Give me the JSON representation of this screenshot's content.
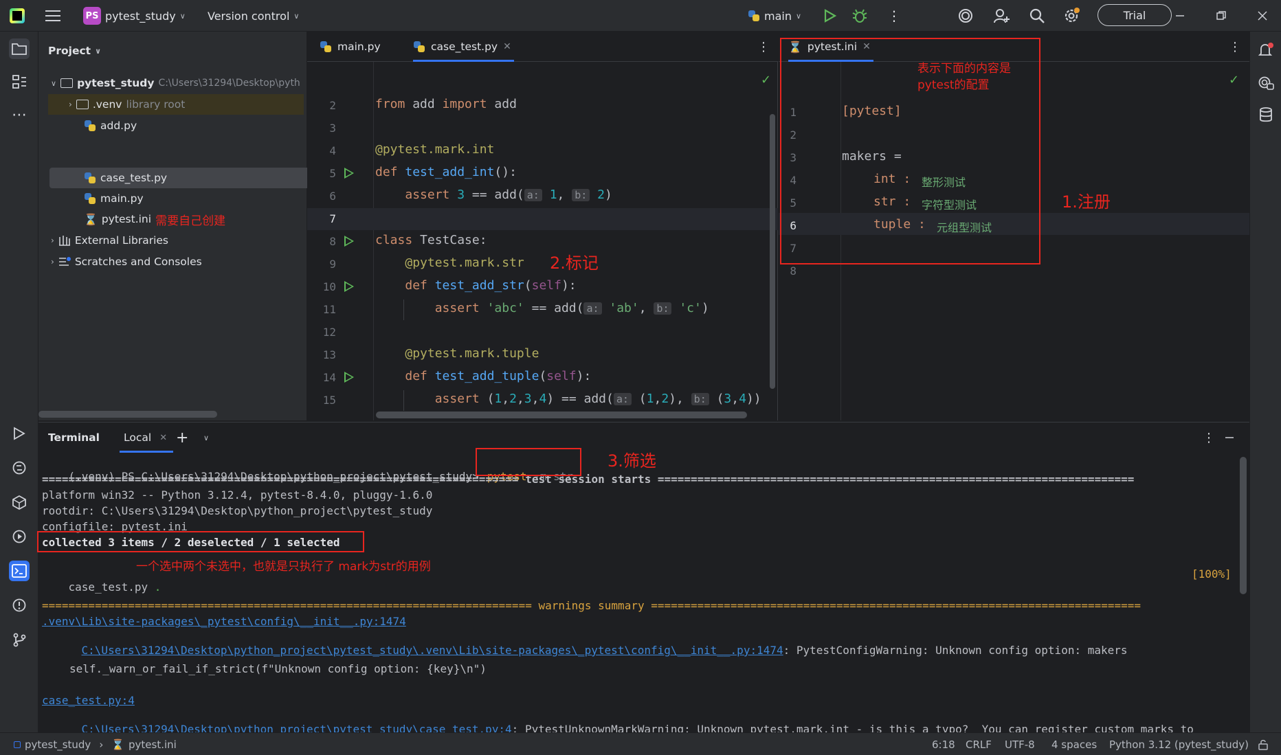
{
  "titlebar": {
    "project_badge": "PS",
    "project_name": "pytest_study",
    "vcs": "Version control",
    "branch": "main",
    "trial": "Trial"
  },
  "project_panel": {
    "title": "Project",
    "root_name": "pytest_study",
    "root_path": "C:\\Users\\31294\\Desktop\\pyth",
    "venv": ".venv",
    "venv_note": "library root",
    "files": [
      "add.py",
      "case_test.py",
      "main.py",
      "pytest.ini"
    ],
    "note_create": "需要自己创建",
    "external": "External Libraries",
    "scratches": "Scratches and Consoles"
  },
  "left_editor": {
    "tabs": [
      "main.py",
      "case_test.py"
    ],
    "line_numbers": [
      "2",
      "3",
      "4",
      "5",
      "6",
      "7",
      "8",
      "9",
      "10",
      "11",
      "12",
      "13",
      "14",
      "15"
    ],
    "annotation": "2.标记"
  },
  "right_editor": {
    "tab": "pytest.ini",
    "line_numbers": [
      "1",
      "2",
      "3",
      "4",
      "5",
      "6",
      "7",
      "8"
    ],
    "lines": {
      "l1": "[pytest]",
      "l3": "makers =",
      "l4_key": "int :",
      "l4_val": "整形测试",
      "l5_key": "str :",
      "l5_val": "字符型测试",
      "l6_key": "tuple :",
      "l6_val": "元组型测试"
    },
    "note_top_1": "表示下面的内容是",
    "note_top_2": "pytest的配置",
    "annotation": "1.注册"
  },
  "terminal": {
    "title": "Terminal",
    "tab": "Local",
    "prompt": "(.venv) PS C:\\Users\\31294\\Desktop\\python_project\\pytest_study>",
    "cmd_main": "pytest",
    "cmd_args": " -m str",
    "annotation_filter": "3.筛选",
    "session_line": "======================================================================== test session starts ========================================================================",
    "platform": "platform win32 -- Python 3.12.4, pytest-8.4.0, pluggy-1.6.0",
    "rootdir": "rootdir: C:\\Users\\31294\\Desktop\\python_project\\pytest_study",
    "configfile": "configfile: pytest.ini",
    "collected": "collected 3 items / 2 deselected / 1 selected",
    "case_file": "case_test.py",
    "case_dot": ".",
    "progress": "[100%]",
    "note_selected": "一个选中两个未选中，也就是只执行了 mark为str的用例",
    "warn_line": "========================================================================== warnings summary ==========================================================================",
    "warn1_link": ".venv\\Lib\\site-packages\\_pytest\\config\\__init__.py:1474",
    "warn2_link": "C:\\Users\\31294\\Desktop\\python_project\\pytest_study\\.venv\\Lib\\site-packages\\_pytest\\config\\__init__.py:1474",
    "warn2_text": ": PytestConfigWarning: Unknown config option: makers",
    "warn3": "self._warn_or_fail_if_strict(f\"Unknown config option: {key}\\n\")",
    "warn4_link": "case_test.py:4",
    "warn5_link": "C:\\Users\\31294\\Desktop\\python_project\\pytest_study\\case_test.py:4",
    "warn5_text": ": PytestUnknownMarkWarning: Unknown pytest.mark.int - is this a typo?  You can register custom marks to"
  },
  "statusbar": {
    "crumb1": "pytest_study",
    "crumb2": "pytest.ini",
    "position": "6:18",
    "line_sep": "CRLF",
    "encoding": "UTF-8",
    "indent": "4 spaces",
    "interpreter": "Python 3.12 (pytest_study)"
  }
}
